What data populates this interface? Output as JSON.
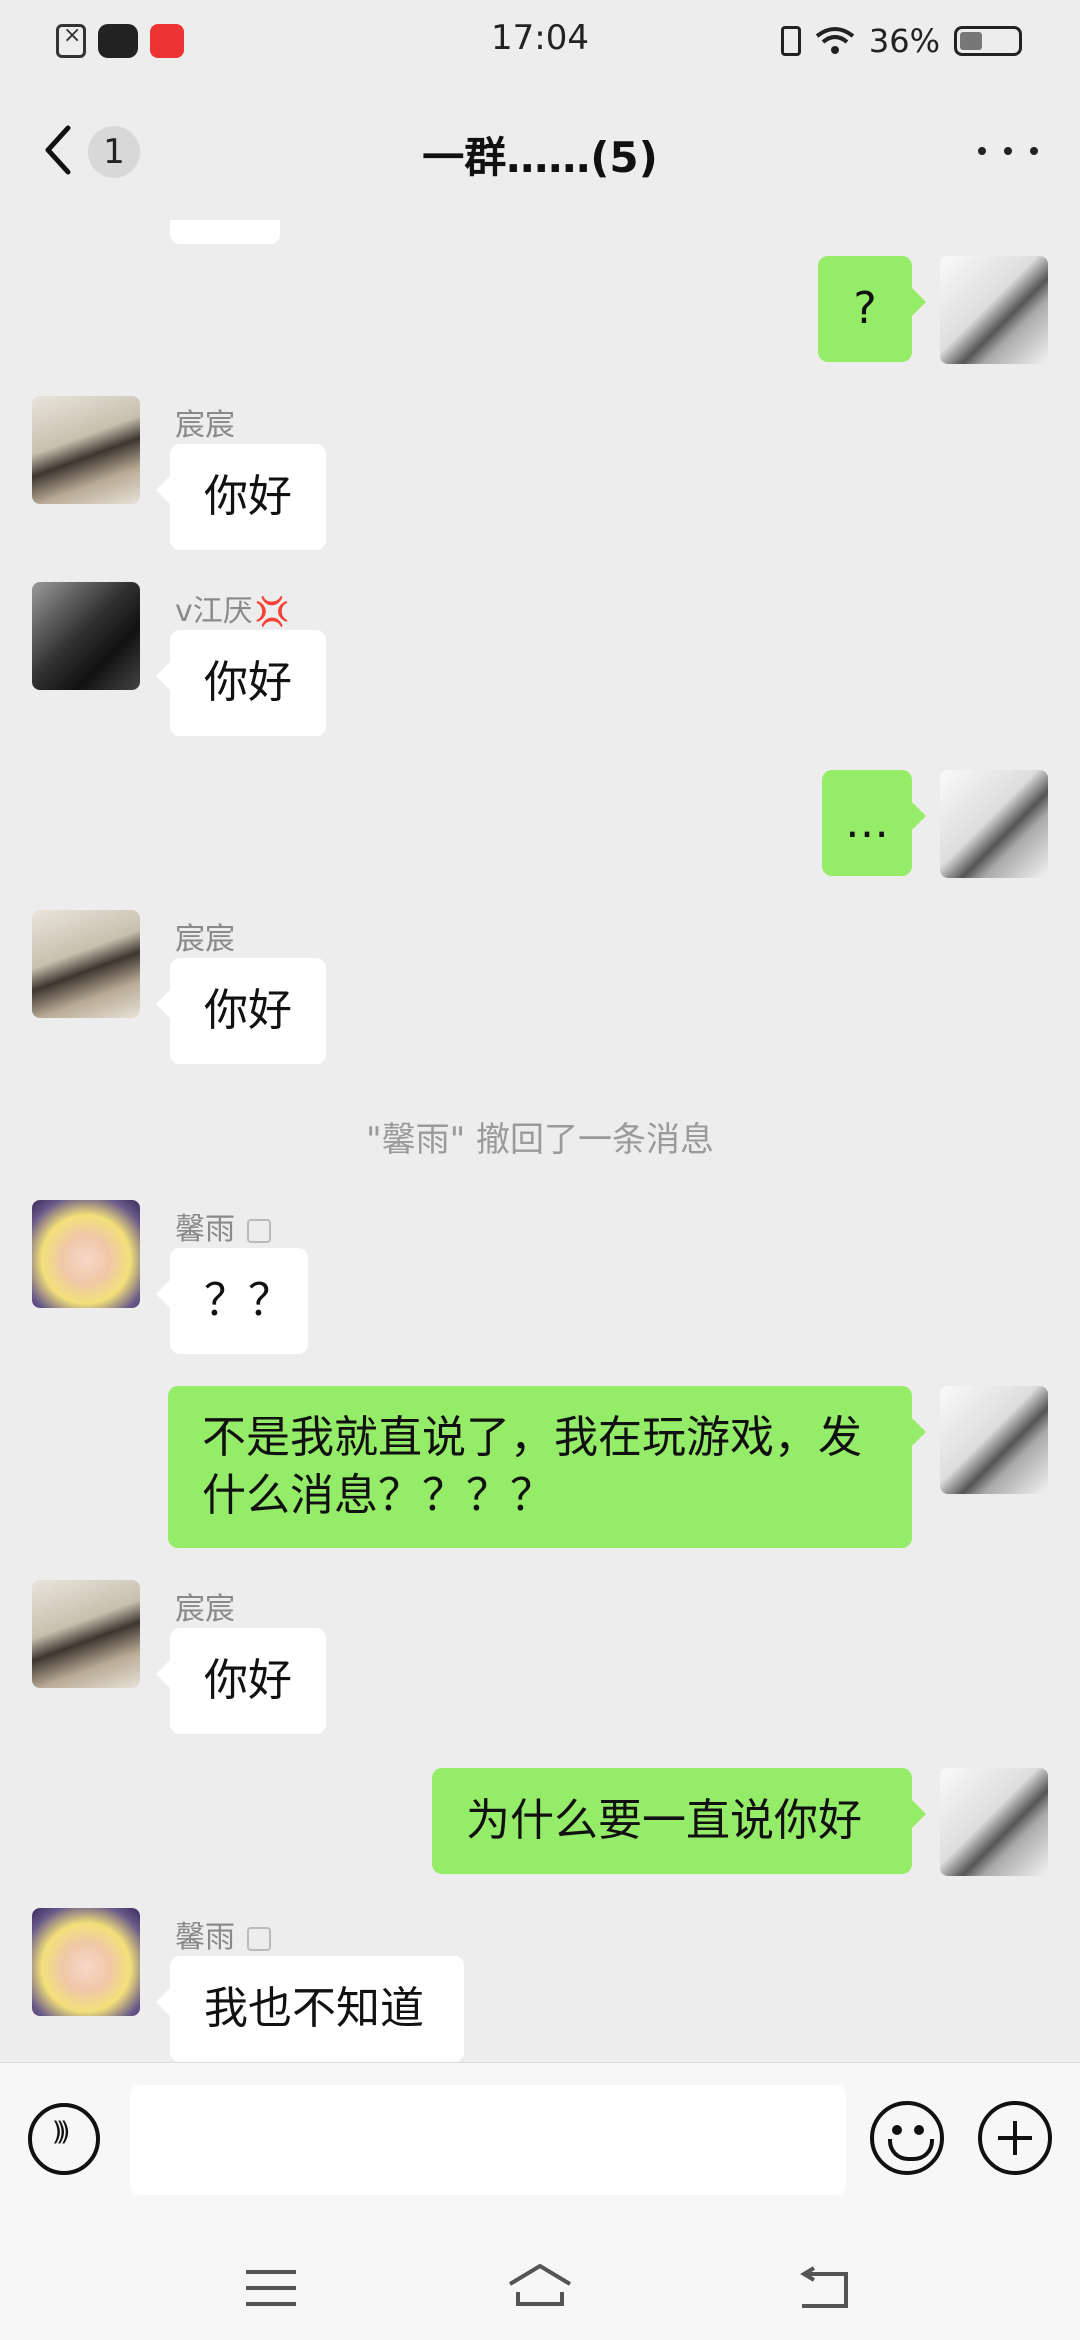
{
  "status_bar": {
    "time": "17:04",
    "battery": "36%"
  },
  "header": {
    "back_count": "1",
    "title": "一群……(5)"
  },
  "messages": [
    {
      "side": "right",
      "text": "?"
    },
    {
      "side": "left",
      "sender": "宸宸",
      "text": "你好"
    },
    {
      "side": "left",
      "sender": "v江厌",
      "text": "你好"
    },
    {
      "side": "right",
      "text": "…"
    },
    {
      "side": "left",
      "sender": "宸宸",
      "text": "你好"
    },
    {
      "type": "system",
      "text": "\"馨雨\" 撤回了一条消息"
    },
    {
      "side": "left",
      "sender": "馨雨",
      "text": "？？"
    },
    {
      "side": "right",
      "text_line1": "不是我就直说了，我在玩游戏，发",
      "text_line2": "什么消息？？？？"
    },
    {
      "side": "left",
      "sender": "宸宸",
      "text": "你好"
    },
    {
      "side": "right",
      "text": "为什么要一直说你好"
    },
    {
      "side": "left",
      "sender": "馨雨",
      "text": "我也不知道"
    }
  ],
  "input": {
    "value": ""
  },
  "icons": {
    "back": "chevron-left-icon",
    "more": "more-icon",
    "voice": "voice-icon",
    "emoji": "emoji-icon",
    "plus": "plus-icon",
    "angry": "anger-symbol-icon"
  },
  "colors": {
    "bubble_self": "#95ec69",
    "bubble_other": "#ffffff",
    "background": "#ededed"
  }
}
